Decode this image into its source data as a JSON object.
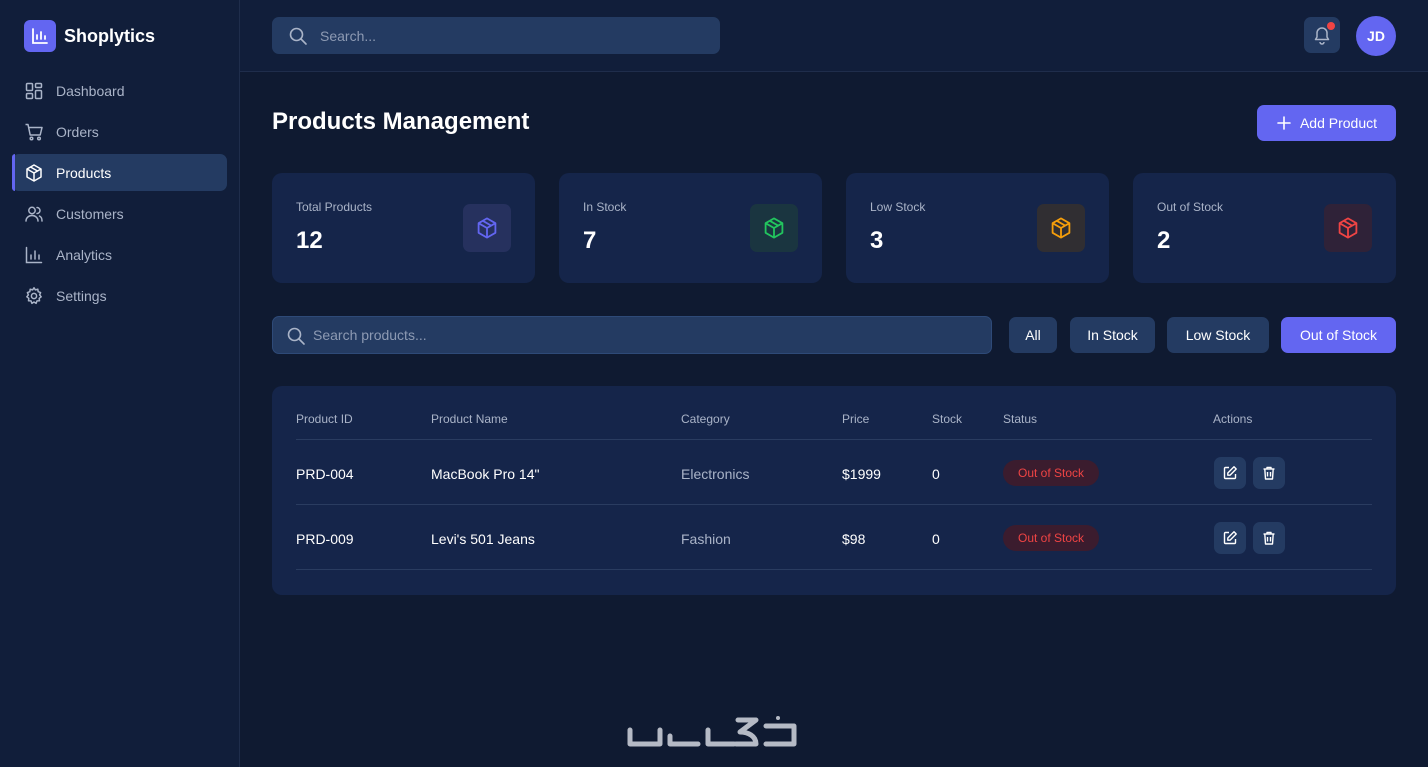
{
  "brand": {
    "name": "Shoplytics"
  },
  "sidebar": {
    "items": [
      {
        "label": "Dashboard",
        "icon": "grid-icon",
        "active": false
      },
      {
        "label": "Orders",
        "icon": "cart-icon",
        "active": false
      },
      {
        "label": "Products",
        "icon": "box-icon",
        "active": true
      },
      {
        "label": "Customers",
        "icon": "users-icon",
        "active": false
      },
      {
        "label": "Analytics",
        "icon": "bar-chart-icon",
        "active": false
      },
      {
        "label": "Settings",
        "icon": "gear-icon",
        "active": false
      }
    ]
  },
  "topbar": {
    "search_placeholder": "Search...",
    "notifications_unread": true,
    "user_initials": "JD"
  },
  "page": {
    "title": "Products Management",
    "add_button_label": "Add Product"
  },
  "stats": [
    {
      "label": "Total Products",
      "value": "12",
      "color": "#6366f1"
    },
    {
      "label": "In Stock",
      "value": "7",
      "color": "#22c55e"
    },
    {
      "label": "Low Stock",
      "value": "3",
      "color": "#f59e0b"
    },
    {
      "label": "Out of Stock",
      "value": "2",
      "color": "#ef4444"
    }
  ],
  "filters": {
    "search_placeholder": "Search products...",
    "chips": [
      {
        "label": "All",
        "active": false
      },
      {
        "label": "In Stock",
        "active": false
      },
      {
        "label": "Low Stock",
        "active": false
      },
      {
        "label": "Out of Stock",
        "active": true
      }
    ]
  },
  "table": {
    "columns": [
      "Product ID",
      "Product Name",
      "Category",
      "Price",
      "Stock",
      "Status",
      "Actions"
    ],
    "rows": [
      {
        "id": "PRD-004",
        "name": "MacBook Pro 14\"",
        "category": "Electronics",
        "price": "$1999",
        "stock": "0",
        "status": "Out of Stock"
      },
      {
        "id": "PRD-009",
        "name": "Levi's 501 Jeans",
        "category": "Fashion",
        "price": "$98",
        "stock": "0",
        "status": "Out of Stock"
      }
    ]
  },
  "colors": {
    "accent": "#6366f1",
    "background": "#0f1a31",
    "panel": "#111e3a",
    "card": "#15254a",
    "danger": "#ef4444"
  }
}
